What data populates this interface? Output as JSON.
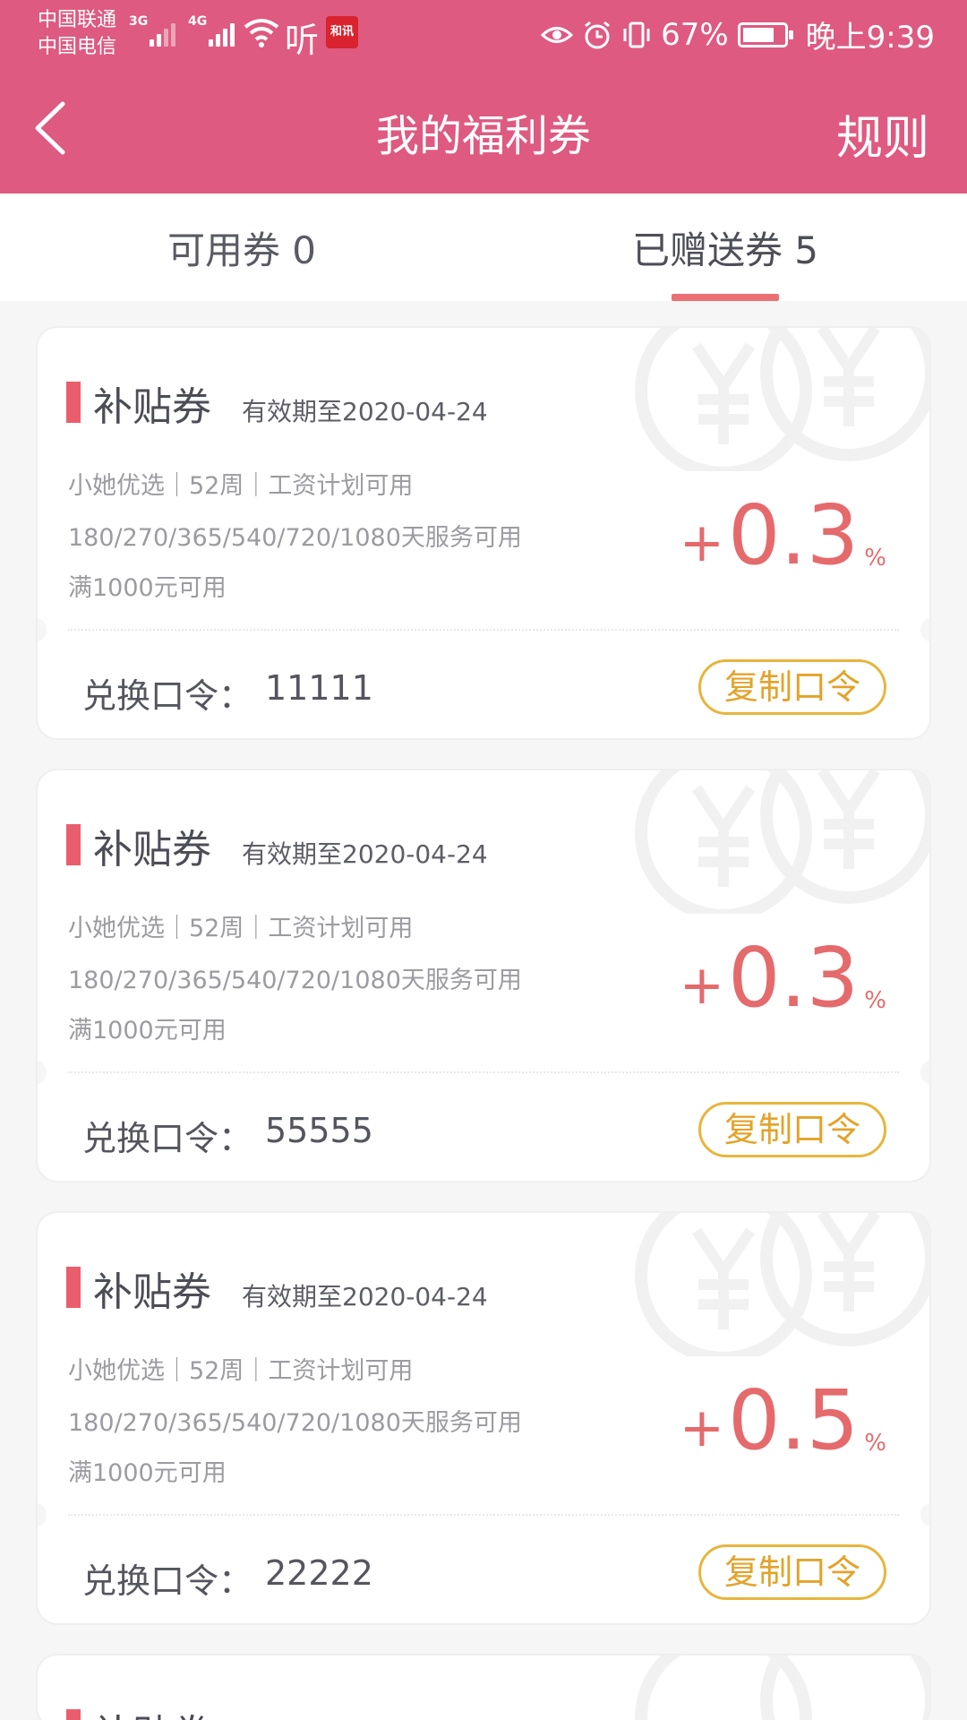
{
  "status_bar": {
    "carrier_1": "中国联通",
    "carrier_2": "中国电信",
    "net_1": "3G",
    "net_2": "4G",
    "app_badge": "和讯",
    "listen_icon_text": "听",
    "battery": "67%",
    "time": "晚上9:39"
  },
  "nav": {
    "title": "我的福利券",
    "rules": "规则"
  },
  "tabs": [
    {
      "label": "可用券 0",
      "active": false
    },
    {
      "label": "已赠送券 5",
      "active": true
    }
  ],
  "coupons": [
    {
      "title": "补贴券",
      "expiry": "有效期至2020-04-24",
      "line1": "小她优选｜52周｜工资计划可用",
      "line2": "180/270/365/540/720/1080天服务可用",
      "line3": "满1000元可用",
      "plus": "+",
      "rate": "0.3",
      "pct": "%",
      "code_label": "兑换口令：",
      "code": "11111",
      "copy_label": "复制口令"
    },
    {
      "title": "补贴券",
      "expiry": "有效期至2020-04-24",
      "line1": "小她优选｜52周｜工资计划可用",
      "line2": "180/270/365/540/720/1080天服务可用",
      "line3": "满1000元可用",
      "plus": "+",
      "rate": "0.3",
      "pct": "%",
      "code_label": "兑换口令：",
      "code": "55555",
      "copy_label": "复制口令"
    },
    {
      "title": "补贴券",
      "expiry": "有效期至2020-04-24",
      "line1": "小她优选｜52周｜工资计划可用",
      "line2": "180/270/365/540/720/1080天服务可用",
      "line3": "满1000元可用",
      "plus": "+",
      "rate": "0.5",
      "pct": "%",
      "code_label": "兑换口令：",
      "code": "22222",
      "copy_label": "复制口令"
    },
    {
      "title": "补贴券"
    }
  ],
  "colors": {
    "header": "#de5a80",
    "accent": "#e95e6d",
    "rate": "#e56a6c",
    "copy_button": "#e8b53c"
  }
}
